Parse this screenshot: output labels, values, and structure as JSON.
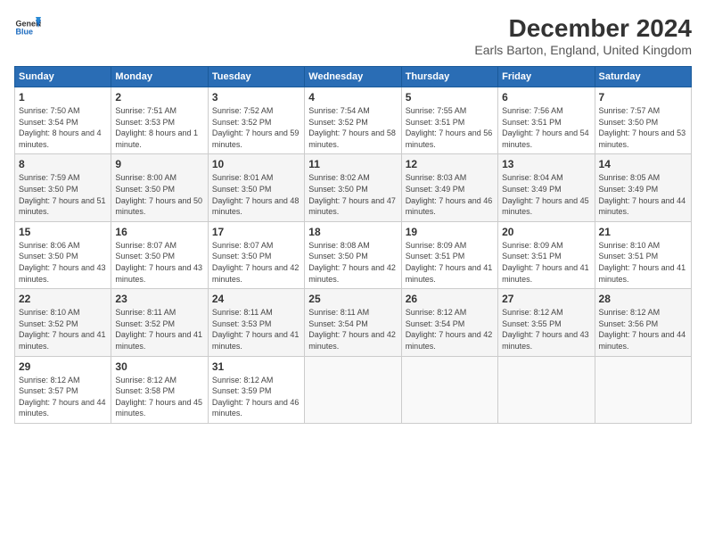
{
  "logo": {
    "line1": "General",
    "line2": "Blue"
  },
  "title": "December 2024",
  "subtitle": "Earls Barton, England, United Kingdom",
  "headers": [
    "Sunday",
    "Monday",
    "Tuesday",
    "Wednesday",
    "Thursday",
    "Friday",
    "Saturday"
  ],
  "weeks": [
    [
      {
        "day": "1",
        "sunrise": "7:50 AM",
        "sunset": "3:54 PM",
        "daylight": "8 hours and 4 minutes."
      },
      {
        "day": "2",
        "sunrise": "7:51 AM",
        "sunset": "3:53 PM",
        "daylight": "8 hours and 1 minute."
      },
      {
        "day": "3",
        "sunrise": "7:52 AM",
        "sunset": "3:52 PM",
        "daylight": "7 hours and 59 minutes."
      },
      {
        "day": "4",
        "sunrise": "7:54 AM",
        "sunset": "3:52 PM",
        "daylight": "7 hours and 58 minutes."
      },
      {
        "day": "5",
        "sunrise": "7:55 AM",
        "sunset": "3:51 PM",
        "daylight": "7 hours and 56 minutes."
      },
      {
        "day": "6",
        "sunrise": "7:56 AM",
        "sunset": "3:51 PM",
        "daylight": "7 hours and 54 minutes."
      },
      {
        "day": "7",
        "sunrise": "7:57 AM",
        "sunset": "3:50 PM",
        "daylight": "7 hours and 53 minutes."
      }
    ],
    [
      {
        "day": "8",
        "sunrise": "7:59 AM",
        "sunset": "3:50 PM",
        "daylight": "7 hours and 51 minutes."
      },
      {
        "day": "9",
        "sunrise": "8:00 AM",
        "sunset": "3:50 PM",
        "daylight": "7 hours and 50 minutes."
      },
      {
        "day": "10",
        "sunrise": "8:01 AM",
        "sunset": "3:50 PM",
        "daylight": "7 hours and 48 minutes."
      },
      {
        "day": "11",
        "sunrise": "8:02 AM",
        "sunset": "3:50 PM",
        "daylight": "7 hours and 47 minutes."
      },
      {
        "day": "12",
        "sunrise": "8:03 AM",
        "sunset": "3:49 PM",
        "daylight": "7 hours and 46 minutes."
      },
      {
        "day": "13",
        "sunrise": "8:04 AM",
        "sunset": "3:49 PM",
        "daylight": "7 hours and 45 minutes."
      },
      {
        "day": "14",
        "sunrise": "8:05 AM",
        "sunset": "3:49 PM",
        "daylight": "7 hours and 44 minutes."
      }
    ],
    [
      {
        "day": "15",
        "sunrise": "8:06 AM",
        "sunset": "3:50 PM",
        "daylight": "7 hours and 43 minutes."
      },
      {
        "day": "16",
        "sunrise": "8:07 AM",
        "sunset": "3:50 PM",
        "daylight": "7 hours and 43 minutes."
      },
      {
        "day": "17",
        "sunrise": "8:07 AM",
        "sunset": "3:50 PM",
        "daylight": "7 hours and 42 minutes."
      },
      {
        "day": "18",
        "sunrise": "8:08 AM",
        "sunset": "3:50 PM",
        "daylight": "7 hours and 42 minutes."
      },
      {
        "day": "19",
        "sunrise": "8:09 AM",
        "sunset": "3:51 PM",
        "daylight": "7 hours and 41 minutes."
      },
      {
        "day": "20",
        "sunrise": "8:09 AM",
        "sunset": "3:51 PM",
        "daylight": "7 hours and 41 minutes."
      },
      {
        "day": "21",
        "sunrise": "8:10 AM",
        "sunset": "3:51 PM",
        "daylight": "7 hours and 41 minutes."
      }
    ],
    [
      {
        "day": "22",
        "sunrise": "8:10 AM",
        "sunset": "3:52 PM",
        "daylight": "7 hours and 41 minutes."
      },
      {
        "day": "23",
        "sunrise": "8:11 AM",
        "sunset": "3:52 PM",
        "daylight": "7 hours and 41 minutes."
      },
      {
        "day": "24",
        "sunrise": "8:11 AM",
        "sunset": "3:53 PM",
        "daylight": "7 hours and 41 minutes."
      },
      {
        "day": "25",
        "sunrise": "8:11 AM",
        "sunset": "3:54 PM",
        "daylight": "7 hours and 42 minutes."
      },
      {
        "day": "26",
        "sunrise": "8:12 AM",
        "sunset": "3:54 PM",
        "daylight": "7 hours and 42 minutes."
      },
      {
        "day": "27",
        "sunrise": "8:12 AM",
        "sunset": "3:55 PM",
        "daylight": "7 hours and 43 minutes."
      },
      {
        "day": "28",
        "sunrise": "8:12 AM",
        "sunset": "3:56 PM",
        "daylight": "7 hours and 44 minutes."
      }
    ],
    [
      {
        "day": "29",
        "sunrise": "8:12 AM",
        "sunset": "3:57 PM",
        "daylight": "7 hours and 44 minutes."
      },
      {
        "day": "30",
        "sunrise": "8:12 AM",
        "sunset": "3:58 PM",
        "daylight": "7 hours and 45 minutes."
      },
      {
        "day": "31",
        "sunrise": "8:12 AM",
        "sunset": "3:59 PM",
        "daylight": "7 hours and 46 minutes."
      },
      null,
      null,
      null,
      null
    ]
  ],
  "daylight_label": "Daylight:",
  "sunrise_label": "Sunrise:",
  "sunset_label": "Sunset:"
}
